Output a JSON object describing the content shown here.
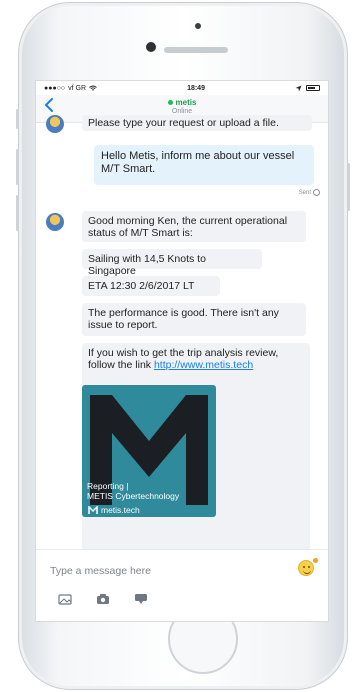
{
  "statusbar": {
    "carrier": "vf GR",
    "time": "18:49"
  },
  "navbar": {
    "back_icon": "chevron-left-icon",
    "contact_name": "metis",
    "contact_status": "Online"
  },
  "chat": {
    "partial_previous_text": "Please type your request or upload a file.",
    "user_message": "Hello Metis, inform me about our vessel M/T Smart.",
    "sent_label": "Sent",
    "bot_messages": [
      "Good morning Ken, the current operational status of M/T Smart is:",
      "Sailing with 14,5 Knots to Singapore",
      "ETA 12:30 2/6/2017 LT",
      "The performance is good. There isn't any issue to report.",
      "If you wish to get the trip analysis review, follow the link"
    ],
    "link_text": "http://www.metis.tech",
    "card": {
      "caption_line1": "Reporting |",
      "caption_line2": "METIS Cybertechnology",
      "brand": "metis.tech"
    }
  },
  "composer": {
    "placeholder": "Type a message here",
    "icons": [
      "gallery-icon",
      "camera-icon",
      "location-icon",
      "emoji-icon"
    ]
  },
  "colors": {
    "accent": "#1a7fe0",
    "online": "#29b45c",
    "user_bubble": "#e3f2fb",
    "bot_bubble": "#f0f2f5",
    "card": "#2f8b9b"
  }
}
